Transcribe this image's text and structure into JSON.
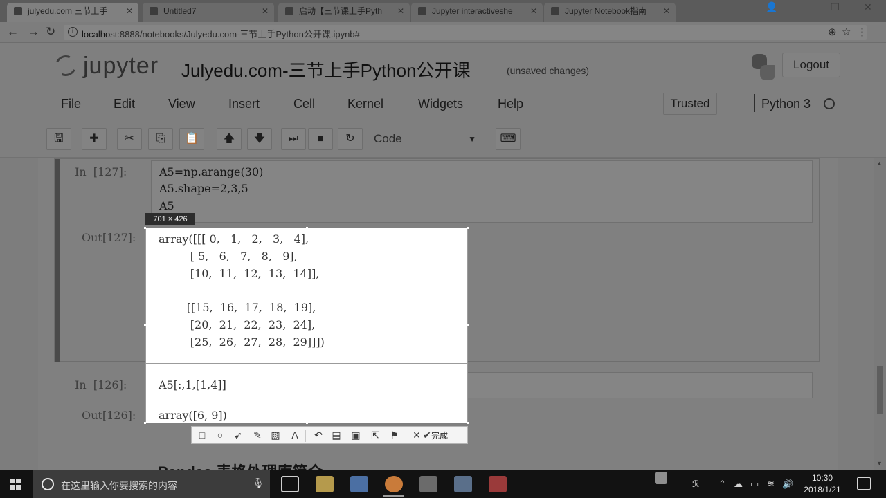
{
  "browser": {
    "tabs": [
      {
        "title": "julyedu.com 三节上手"
      },
      {
        "title": "Untitled7"
      },
      {
        "title": "启动【三节课上手Pyth"
      },
      {
        "title": "Jupyter interactiveshe"
      },
      {
        "title": "Jupyter Notebook指南"
      }
    ],
    "url_host": "localhost",
    "url_rest": ":8888/notebooks/Julyedu.com-三节上手Python公开课.ipynb#"
  },
  "jupyter": {
    "logo_text": "jupyter",
    "notebook_title": "Julyedu.com-三节上手Python公开课",
    "save_status": "(unsaved changes)",
    "logout_label": "Logout",
    "menu": [
      "File",
      "Edit",
      "View",
      "Insert",
      "Cell",
      "Kernel",
      "Widgets",
      "Help"
    ],
    "trusted_label": "Trusted",
    "kernel_name": "Python 3",
    "cell_type": "Code"
  },
  "cells": {
    "cell127": {
      "in_prompt": "In  [127]:",
      "code": [
        "A5=np.arange(30)",
        "A5.shape=2,3,5",
        "A5"
      ],
      "out_prompt": "Out[127]:"
    },
    "cell126": {
      "in_prompt": "In  [126]:",
      "out_prompt": "Out[126]:"
    },
    "next_heading": "Pandas  表格处理库简介"
  },
  "capture": {
    "size_label": "701 × 426",
    "output127": [
      "array([[[ 0,   1,   2,   3,   4],",
      "         [ 5,   6,   7,   8,   9],",
      "         [10,  11,  12,  13,  14]],",
      "",
      "        [[15,  16,  17,  18,  19],",
      "         [20,  21,  22,  23,  24],",
      "         [25,  26,  27,  28,  29]]])"
    ],
    "code126": "A5[:,1,[1,4]]",
    "output126": "array([6, 9])",
    "done_label": "完成"
  },
  "taskbar": {
    "search_placeholder": "在这里输入你要搜索的内容",
    "time": "10:30",
    "date": "2018/1/21"
  }
}
